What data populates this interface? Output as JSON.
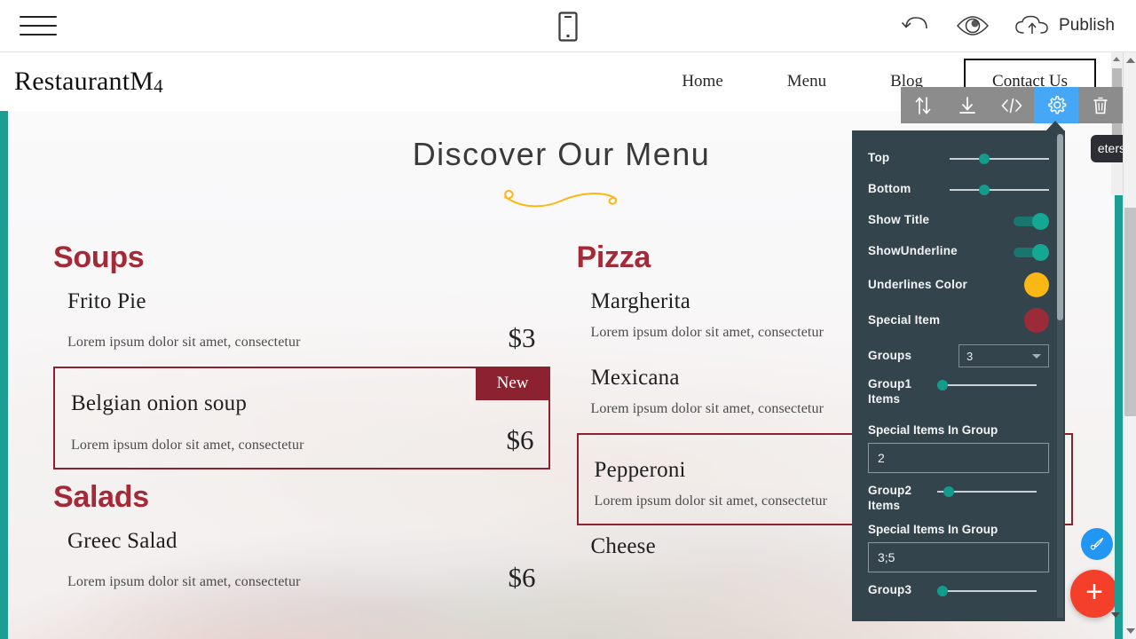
{
  "builder_bar": {
    "menu_icon": "hamburger-menu-icon",
    "device_preview_icon": "mobile-phone-icon",
    "undo_icon": "undo-arrow-icon",
    "preview_icon": "eye-preview-icon",
    "publish_icon": "cloud-upload-icon",
    "publish_label": "Publish"
  },
  "block_toolbar": {
    "buttons": [
      {
        "name": "move-block",
        "icon": "up-down-arrows-icon",
        "active": false
      },
      {
        "name": "save-block",
        "icon": "download-arrow-icon",
        "active": false
      },
      {
        "name": "edit-code",
        "icon": "code-brackets-icon",
        "active": false
      },
      {
        "name": "block-parameters",
        "icon": "gear-settings-icon",
        "active": true
      },
      {
        "name": "delete-block",
        "icon": "trash-can-icon",
        "active": false
      }
    ],
    "active_color": "#45a7f5",
    "tooltip_text": "eters"
  },
  "site": {
    "logo": "RestaurantM",
    "logo_sub": "4",
    "nav": [
      {
        "label": "Home"
      },
      {
        "label": "Menu"
      },
      {
        "label": "Blog"
      }
    ],
    "contact_button": "Contact Us"
  },
  "menu_section": {
    "title": "Discover Our Menu",
    "underline_color": "#FBB713",
    "accent_color": "#a52a38",
    "special_border_color": "#8c2230",
    "groups": [
      {
        "title": "Soups",
        "items": [
          {
            "name": "Frito Pie",
            "desc": "Lorem ipsum dolor sit amet, consectetur",
            "price": "$3",
            "special": false,
            "badge": ""
          },
          {
            "name": "Belgian onion soup",
            "desc": "Lorem ipsum dolor sit amet, consectetur",
            "price": "$6",
            "special": true,
            "badge": "New"
          }
        ]
      },
      {
        "title": "Salads",
        "items": [
          {
            "name": "Greec Salad",
            "desc": "Lorem ipsum dolor sit amet, consectetur",
            "price": "$6",
            "special": false,
            "badge": ""
          }
        ]
      },
      {
        "title": "Pizza",
        "items": [
          {
            "name": "Margherita",
            "desc": "Lorem ipsum dolor sit amet, consectetur",
            "price": "",
            "special": false,
            "badge": ""
          },
          {
            "name": "Mexicana",
            "desc": "Lorem ipsum dolor sit amet, consectetur",
            "price": "",
            "special": false,
            "badge": ""
          },
          {
            "name": "Pepperoni",
            "desc": "Lorem ipsum dolor sit amet, consectetur",
            "price": "",
            "special": true,
            "badge": ""
          },
          {
            "name": "Cheese",
            "desc": "",
            "price": "",
            "special": false,
            "badge": ""
          }
        ]
      }
    ]
  },
  "settings_panel": {
    "rows": {
      "top_label": "Top",
      "top_value": 33,
      "bottom_label": "Bottom",
      "bottom_value": 33,
      "show_title_label": "Show Title",
      "show_title_on": true,
      "show_underline_label": "ShowUnderline",
      "show_underline_on": true,
      "underlines_color_label": "Underlines Color",
      "underlines_color_value": "#FBB713",
      "special_item_label": "Special Item",
      "special_item_value": "#9c2b3a",
      "groups_label": "Groups",
      "groups_value": "3",
      "group1_items_label": "Group1 Items",
      "group1_items_value": 3,
      "special_items_in_group1_label": "Special Items In Group",
      "special_items_in_group1_value": "2",
      "group2_items_label": "Group2 Items",
      "group2_items_value": 9,
      "special_items_in_group2_label": "Special Items In Group",
      "special_items_in_group2_value": "3;5",
      "group3_items_label": "Group3",
      "group3_items_value": 5
    },
    "toggle_on_color": "#14a893",
    "slider_knob_color": "#139b8c",
    "background": "#34444d"
  },
  "floating": {
    "pen_icon": "paintbrush-icon",
    "add_icon": "plus-icon",
    "pen_color": "#2196f3",
    "add_color": "#f4402a"
  }
}
